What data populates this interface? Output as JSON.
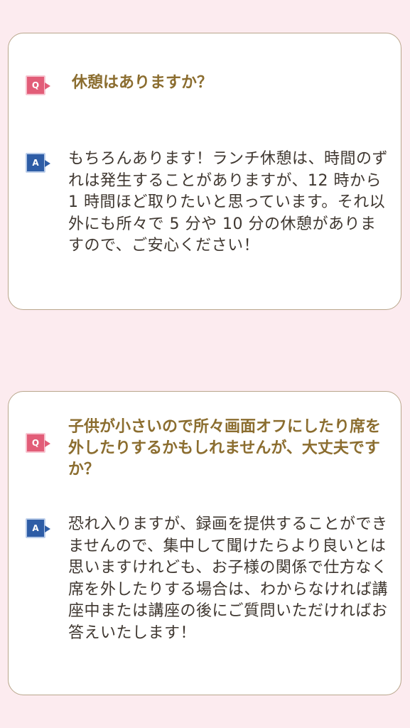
{
  "faqs": [
    {
      "q_badge": "Q",
      "question": "休憩はありますか？",
      "a_badge": "A",
      "answer": "もちろんあります！ランチ休憩は、時間のずれは発生することがありますが、12 時から 1 時間ほど取りたいと思っています。それ以外にも所々で 5 分や 10 分の休憩がありますので、ご安心ください！"
    },
    {
      "q_badge": "Q",
      "question": "子供が小さいので所々画面オフにしたり席を外したりするかもしれませんが、大丈夫ですか？",
      "a_badge": "A",
      "answer": "恐れ入りますが、録画を提供することができませんので、集中して聞けたらより良いとは思いますけれども、お子様の関係で仕方なく席を外したりする場合は、わからなければ講座中または講座の後にご質問いただければお答えいたします！"
    }
  ],
  "colors": {
    "background": "#fcebef",
    "card_border": "#b9a68b",
    "question_text": "#8b6d2f",
    "answer_text": "#3f3730",
    "q_badge": "#e25d78",
    "a_badge": "#2e5da6"
  }
}
